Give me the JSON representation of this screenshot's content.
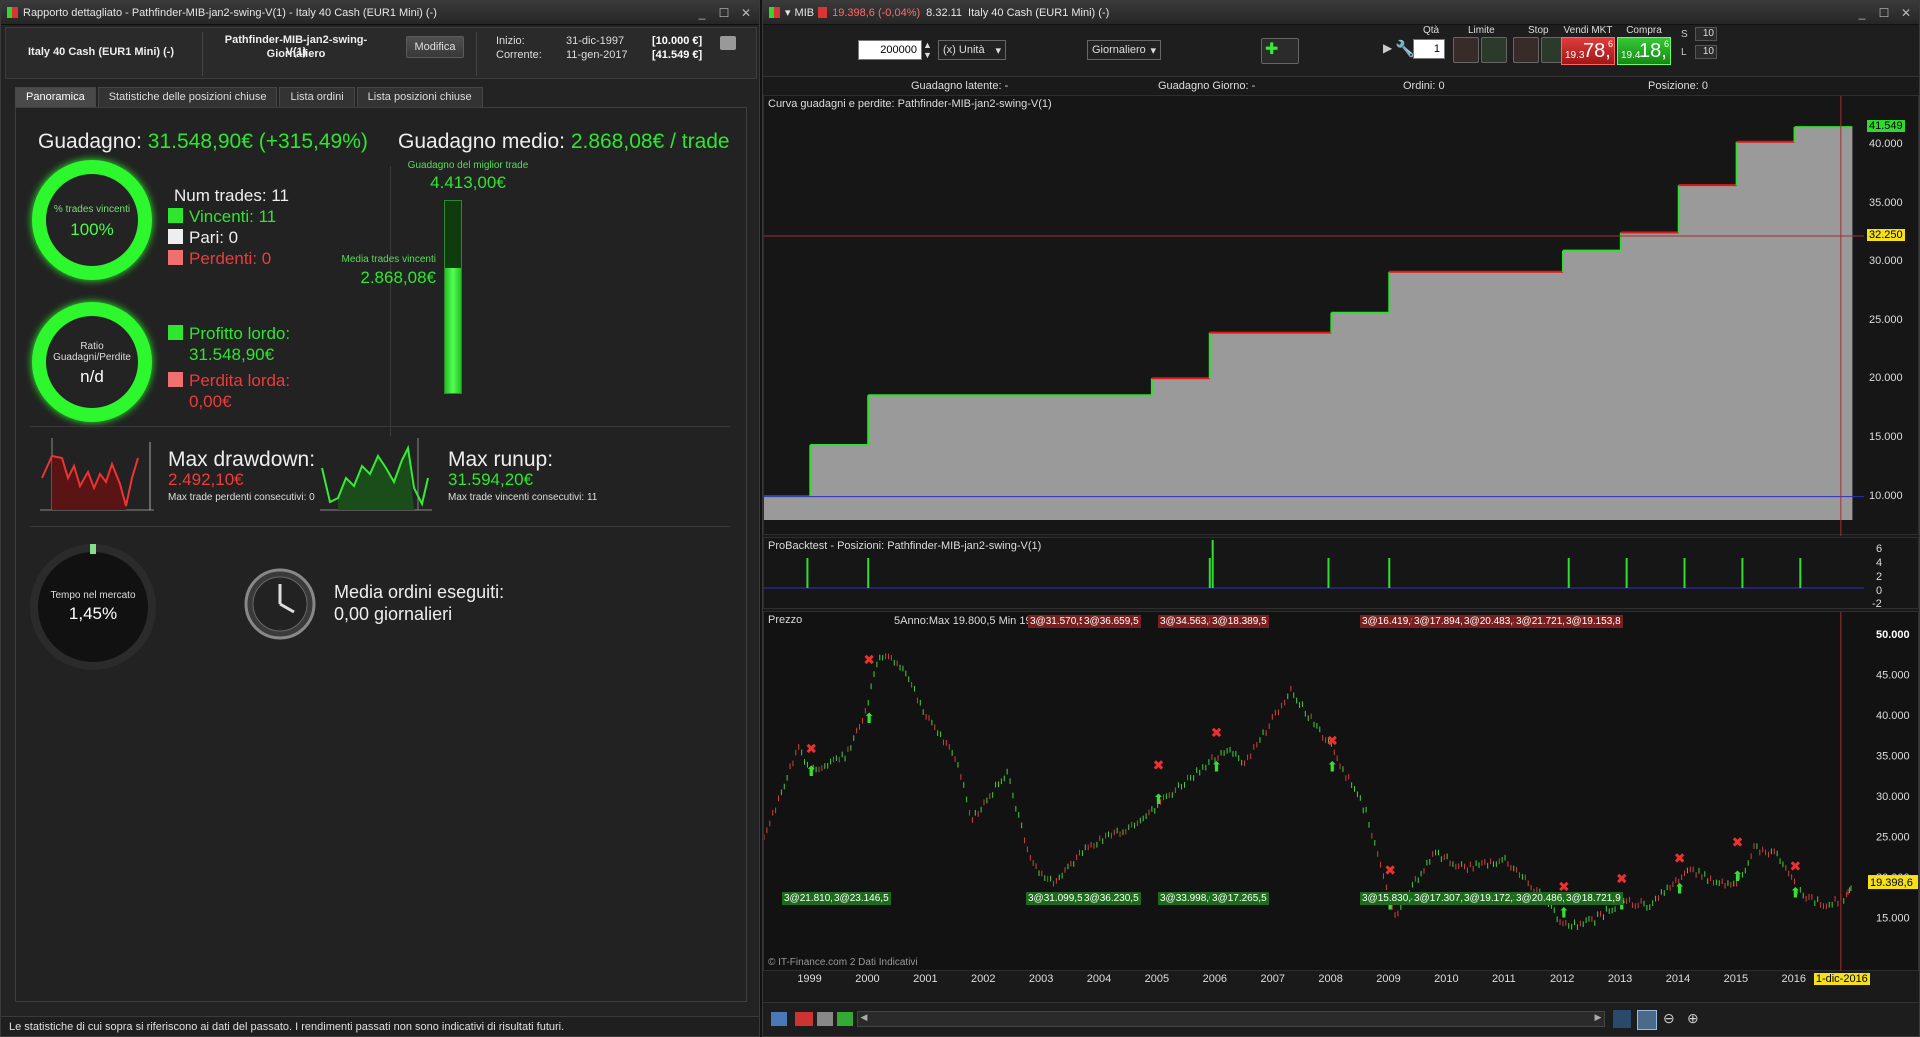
{
  "left": {
    "title": "Rapporto dettagliato - Pathfinder-MIB-jan2-swing-V(1) - Italy 40 Cash (EUR1 Mini) (-)",
    "instrument": "Italy 40 Cash (EUR1 Mini) (-)",
    "system_name": "Pathfinder-MIB-jan2-swing-V(1)",
    "timeframe": "Giornaliero",
    "modify_label": "Modifica",
    "start_label": "Inizio:",
    "start_date": "31-dic-1997",
    "start_value": "[10.000 €]",
    "current_label": "Corrente:",
    "current_date": "11-gen-2017",
    "current_value": "[41.549 €]",
    "tabs": [
      "Panoramica",
      "Statistiche delle posizioni chiuse",
      "Lista ordini",
      "Lista posizioni chiuse"
    ],
    "gain_label": "Guadagno:",
    "gain_value": "31.548,90€ (+315,49%)",
    "avg_label": "Guadagno medio:",
    "avg_value": "2.868,08€ / trade",
    "best_trade_label": "Guadagno del miglior trade",
    "best_trade_value": "4.413,00€",
    "avg_win_label": "Media trades vincenti",
    "avg_win_value": "2.868,08€",
    "avg_win_fraction": 0.65,
    "win_ring_label": "% trades vincenti",
    "win_ring_value": "100%",
    "num_trades": "Num trades: 11",
    "winners": "Vincenti: 11",
    "even": "Pari: 0",
    "losers": "Perdenti: 0",
    "ratio_label_1": "Ratio",
    "ratio_label_2": "Guadagni/Perdite",
    "ratio_value": "n/d",
    "gross_profit_label": "Profitto lordo:",
    "gross_profit_value": "31.548,90€",
    "gross_loss_label": "Perdita lorda:",
    "gross_loss_value": "0,00€",
    "dd_label": "Max drawdown:",
    "dd_value": "2.492,10€",
    "dd_sub": "Max trade perdenti consecutivi: 0",
    "ru_label": "Max runup:",
    "ru_value": "31.594,20€",
    "ru_sub": "Max trade vincenti consecutivi: 11",
    "time_label": "Tempo nel mercato",
    "time_value": "1,45%",
    "orders_label": "Media ordini eseguiti:",
    "orders_value": "0,00 giornalieri",
    "footer": "Le statistiche di cui sopra si riferiscono ai dati del passato. I rendimenti passati non sono indicativi di risultati futuri.",
    "colors": {
      "green": "#2ee62e",
      "red": "#ee3b3b"
    }
  },
  "right": {
    "title_prefix": "MIB",
    "title_change": "19.398,6 (-0,04%)",
    "title_time": "8.32.11",
    "title_instr": "Italy 40 Cash (EUR1 Mini) (-)",
    "qty_value": "200000",
    "unit_label": "(x) Unità",
    "tf_value": "Giornaliero",
    "qta_label": "Qtà",
    "qta_value": "1",
    "limite_label": "Limite",
    "stop_label": "Stop",
    "sell_label": "Vendi MKT",
    "sell_small": "19.3",
    "sell_big": "78,",
    "sell_sup": "6",
    "buy_label": "Compra MKT",
    "buy_small": "19.4",
    "buy_big": "18,",
    "buy_sup": "6",
    "s_label": "S",
    "s_val": "10",
    "l_label": "L",
    "l_val": "10",
    "latent_label": "Guadagno latente:",
    "latent_value": "-",
    "day_gain_label": "Guadagno Giorno:",
    "day_gain_value": "-",
    "orders_label": "Ordini:",
    "orders_value": "0",
    "pos_label": "Posizione:",
    "pos_value": "0",
    "equity_title": "Curva guadagni e perdite: Pathfinder-MIB-jan2-swing-V(1)",
    "equity_axis": [
      "40.000",
      "35.000",
      "30.000",
      "25.000",
      "20.000",
      "15.000",
      "10.000"
    ],
    "equity_last": "41.549",
    "equity_cursor": "32.250",
    "pos_title": "ProBacktest - Posizioni: Pathfinder-MIB-jan2-swing-V(1)",
    "pos_axis": [
      "6",
      "4",
      "2",
      "0",
      "-2"
    ],
    "price_title": "Prezzo",
    "price_info": "5Anno:Max 19.800,5 Min 19.196,5",
    "price_axis": [
      "50.000",
      "45.000",
      "40.000",
      "35.000",
      "30.000",
      "25.000",
      "20.000",
      "15.000"
    ],
    "price_last": "19.398,6",
    "top_tags": [
      "3@31.570,5",
      "3@36.659,5",
      "3@34.563,8",
      "3@18.389,5",
      "3@16.419,9",
      "3@17.894,2",
      "3@20.483,3",
      "3@21.721,0",
      "3@19.153,8"
    ],
    "bottom_tags": [
      "3@21.810,5",
      "3@23.146,5",
      "3@31.099,5",
      "3@36.230,5",
      "3@33.998,6",
      "3@17.265,5",
      "3@15.830,4",
      "3@17.307,0",
      "3@19.172,3",
      "3@20.486,5",
      "3@18.721,9"
    ],
    "watermark": "© IT-Finance.com  2 Dati Indicativi",
    "years": [
      "1999",
      "2000",
      "2001",
      "2002",
      "2003",
      "2004",
      "2005",
      "2006",
      "2007",
      "2008",
      "2009",
      "2010",
      "2011",
      "2012",
      "2013",
      "2014",
      "2015",
      "2016"
    ],
    "cursor_date": "1-dic-2016"
  },
  "chart_data": {
    "type": "line",
    "title": "Curva guadagni e perdite: Pathfinder-MIB-jan2-swing-V(1)",
    "x": [
      1997.9,
      1999.0,
      2000.0,
      2004.9,
      2005.9,
      2008.0,
      2009.0,
      2012.0,
      2013.0,
      2014.0,
      2015.0,
      2016.0,
      2017.0
    ],
    "y": [
      10000,
      14400,
      18650,
      20100,
      24000,
      25700,
      29200,
      31000,
      32550,
      36600,
      40300,
      41549,
      41549
    ],
    "ylim": [
      8000,
      42500
    ]
  }
}
